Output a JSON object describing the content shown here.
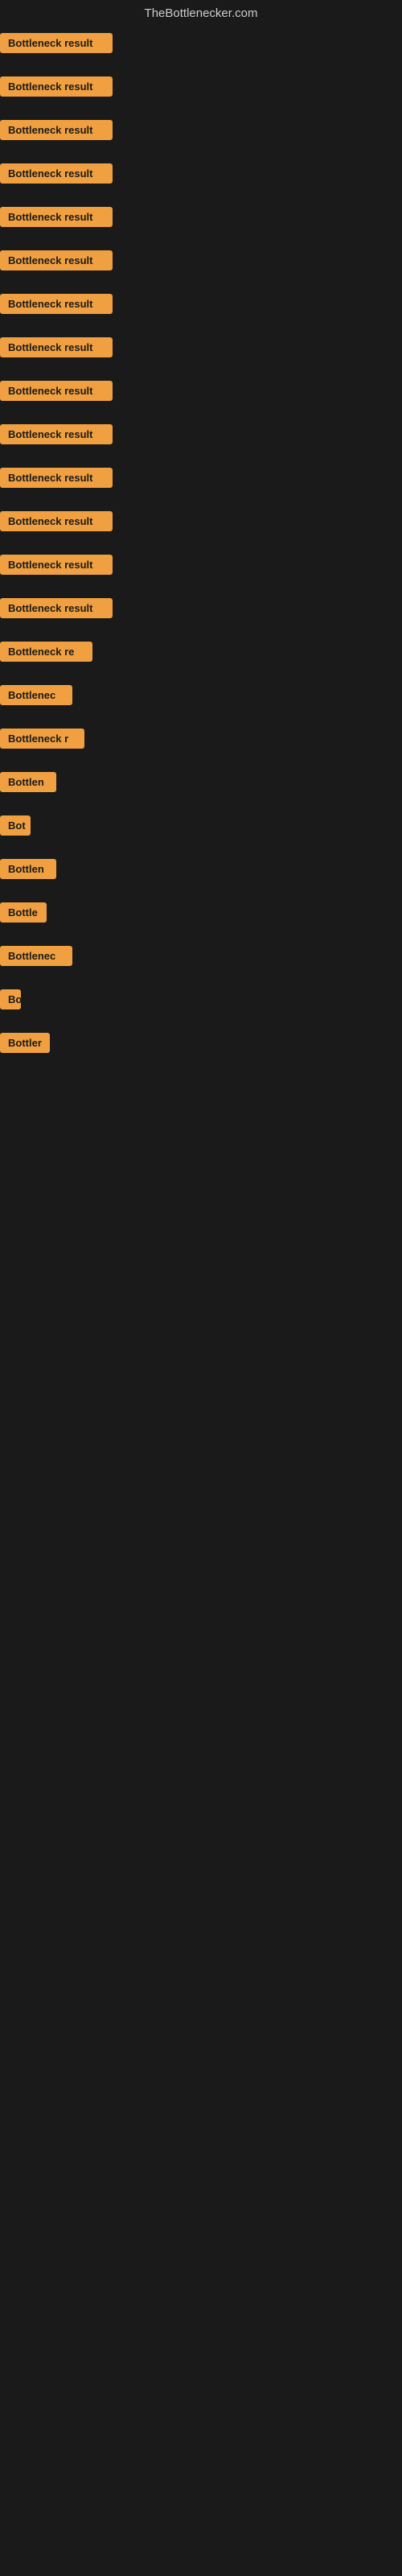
{
  "header": {
    "title": "TheBottlenecker.com"
  },
  "items": [
    {
      "id": 1,
      "label": "Bottleneck result",
      "width": "full"
    },
    {
      "id": 2,
      "label": "Bottleneck result",
      "width": "full"
    },
    {
      "id": 3,
      "label": "Bottleneck result",
      "width": "full"
    },
    {
      "id": 4,
      "label": "Bottleneck result",
      "width": "full"
    },
    {
      "id": 5,
      "label": "Bottleneck result",
      "width": "full"
    },
    {
      "id": 6,
      "label": "Bottleneck result",
      "width": "full"
    },
    {
      "id": 7,
      "label": "Bottleneck result",
      "width": "full"
    },
    {
      "id": 8,
      "label": "Bottleneck result",
      "width": "full"
    },
    {
      "id": 9,
      "label": "Bottleneck result",
      "width": "full"
    },
    {
      "id": 10,
      "label": "Bottleneck result",
      "width": "full"
    },
    {
      "id": 11,
      "label": "Bottleneck result",
      "width": "full"
    },
    {
      "id": 12,
      "label": "Bottleneck result",
      "width": "full"
    },
    {
      "id": 13,
      "label": "Bottleneck result",
      "width": "full"
    },
    {
      "id": 14,
      "label": "Bottleneck result",
      "width": "full"
    },
    {
      "id": 15,
      "label": "Bottleneck re",
      "width": "partial1"
    },
    {
      "id": 16,
      "label": "Bottlenec",
      "width": "partial2"
    },
    {
      "id": 17,
      "label": "Bottleneck r",
      "width": "partial3"
    },
    {
      "id": 18,
      "label": "Bottlen",
      "width": "partial4"
    },
    {
      "id": 19,
      "label": "Bot",
      "width": "partial5"
    },
    {
      "id": 20,
      "label": "Bottlen",
      "width": "partial4"
    },
    {
      "id": 21,
      "label": "Bottle",
      "width": "partial6"
    },
    {
      "id": 22,
      "label": "Bottlenec",
      "width": "partial2"
    },
    {
      "id": 23,
      "label": "Bo",
      "width": "partial7"
    },
    {
      "id": 24,
      "label": "Bottler",
      "width": "partial8"
    }
  ],
  "colors": {
    "badge_bg": "#f0a040",
    "badge_text": "#1a1a1a",
    "body_bg": "#1a1a1a",
    "header_text": "#cccccc"
  },
  "widths": {
    "full": "140px",
    "partial1": "115px",
    "partial2": "90px",
    "partial3": "105px",
    "partial4": "70px",
    "partial5": "38px",
    "partial6": "58px",
    "partial7": "26px",
    "partial8": "62px"
  }
}
